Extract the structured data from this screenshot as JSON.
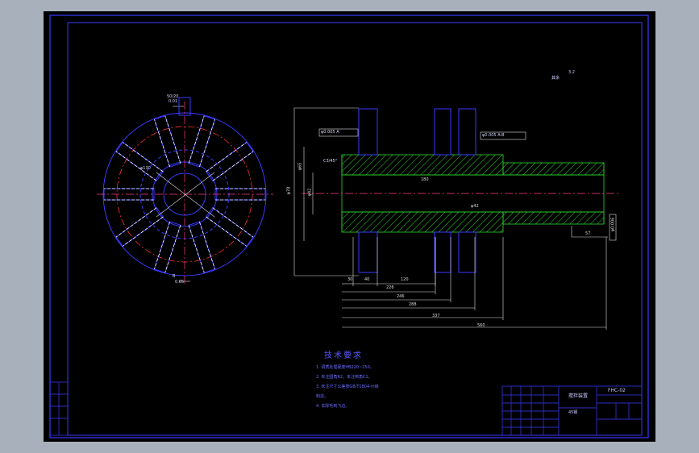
{
  "drawing": {
    "code": "FHC-02",
    "title_text": "搅拌装置",
    "material_text": "45钢",
    "roughness_note": "其余",
    "roughness_value": "3.2"
  },
  "notes": {
    "heading": "技术要求",
    "items": [
      "1. 调质处理硬度HB220~250。",
      "2. 未注圆角R2，未注倒角C1。",
      "3. 未注尺寸公差按GB/T1804-m级",
      "制造。",
      "4. 去除毛刺飞边。"
    ]
  },
  "front_view": {
    "top_note_1": "50/20",
    "top_note_2": "0.01",
    "center_dim": "φ130",
    "bottom_note_1": "B",
    "bottom_note_2": "0.05"
  },
  "section_view": {
    "gdt_left": "φ0.005  A",
    "gdt_right": "φ0.005  A-B",
    "chamfer": "C3/45°",
    "left_dims": [
      "φ78",
      "φ65",
      "φ42"
    ],
    "bottom_dims": [
      "30",
      "40",
      "226",
      "120",
      "246",
      "288",
      "337",
      "560"
    ],
    "mid_dim": "180",
    "right_dims": [
      "57",
      "φ0.006"
    ],
    "bore_label": "φ42"
  }
}
